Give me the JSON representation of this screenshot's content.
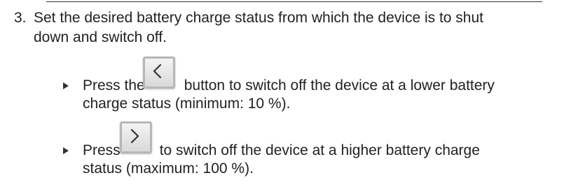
{
  "step": {
    "number": "3.",
    "text_line1": "Set the desired battery charge status from which the device is to shut",
    "text_line2": "down and switch off."
  },
  "bullets": [
    {
      "pre": "Press the",
      "button_icon": "chevron-left-icon",
      "post_line1": "button to switch off the device at a lower battery",
      "line2": "charge status (minimum: 10 %)."
    },
    {
      "pre": "Press",
      "button_icon": "chevron-right-icon",
      "post_line1": "to switch off the device at a higher battery charge",
      "line2": "status (maximum: 100 %)."
    }
  ]
}
